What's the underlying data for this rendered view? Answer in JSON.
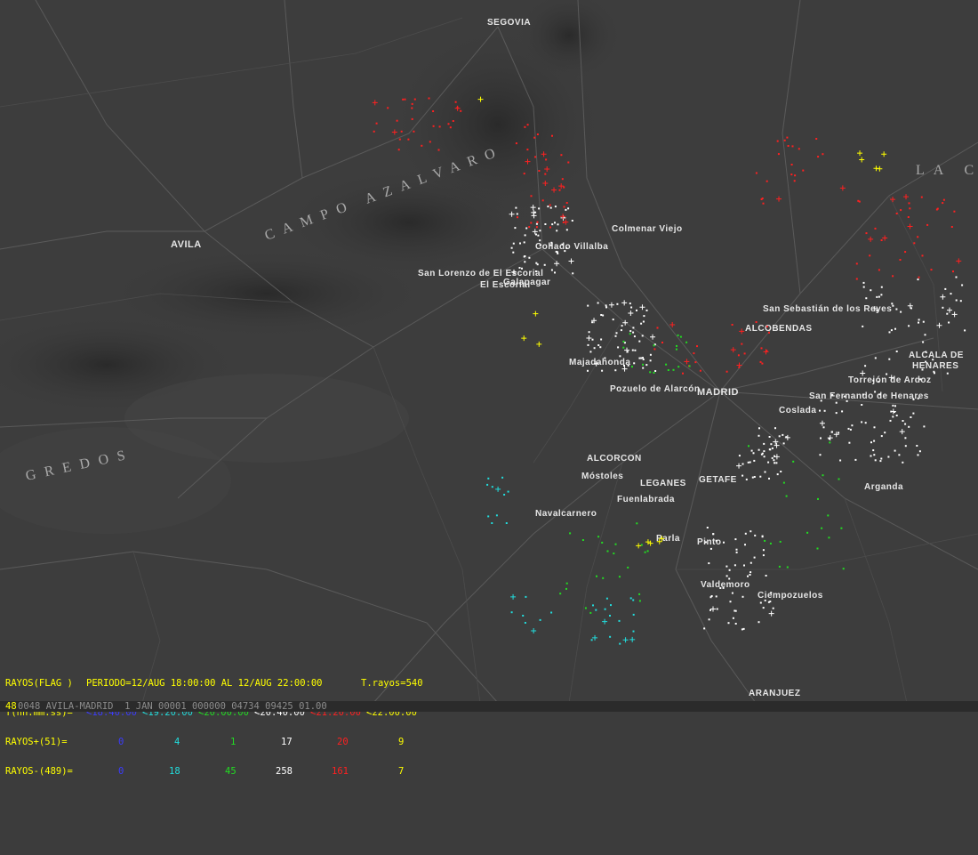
{
  "map": {
    "cities": [
      {
        "name": "SEGOVIA"
      },
      {
        "name": "AVILA"
      },
      {
        "name": "MADRID"
      },
      {
        "name": "ALCOBENDAS"
      },
      {
        "name": "ALCALA DE"
      },
      {
        "name": "HENARES"
      },
      {
        "name": "GETAFE"
      },
      {
        "name": "LEGANES"
      },
      {
        "name": "ALCORCON"
      },
      {
        "name": "ARANJUEZ"
      },
      {
        "name": "Colmenar Viejo"
      },
      {
        "name": "El Escorial"
      },
      {
        "name": "Majadahonda"
      },
      {
        "name": "Fuenlabrada"
      },
      {
        "name": "Móstoles"
      },
      {
        "name": "Parla"
      },
      {
        "name": "Pinto"
      },
      {
        "name": "Valdemoro"
      },
      {
        "name": "Ciempozuelos"
      },
      {
        "name": "Arganda"
      },
      {
        "name": "Coslada"
      },
      {
        "name": "Navalcarnero"
      },
      {
        "name": "San Sebastián de los Reyes"
      },
      {
        "name": "Torrejón de Ardoz"
      },
      {
        "name": "San Fernando de Henares"
      },
      {
        "name": "Collado Villalba"
      },
      {
        "name": "San Lorenzo de El Escorial"
      },
      {
        "name": "Galapagar"
      },
      {
        "name": "Pozuelo de Alarcón"
      }
    ],
    "regions": [
      {
        "name": "GREDOS"
      },
      {
        "name": "CAMPO AZALVARO"
      },
      {
        "name": "LA CAMPIÑA"
      }
    ]
  },
  "strikes": [
    {
      "type": "x",
      "color": "#ffffff",
      "count": 320
    },
    {
      "type": "x",
      "color": "#ff2020",
      "count": 130
    },
    {
      "type": "x",
      "color": "#22dd22",
      "count": 60
    },
    {
      "type": "x",
      "color": "#22dddd",
      "count": 30
    },
    {
      "type": "plus",
      "color": "#ffffff",
      "count": 40
    },
    {
      "type": "plus",
      "color": "#ff2020",
      "count": 25
    },
    {
      "type": "plus",
      "color": "#ffff00",
      "count": 14
    },
    {
      "type": "plus",
      "color": "#22dddd",
      "count": 7
    }
  ],
  "legend": {
    "title": "RAYOS(FLAG )",
    "period": "PERIODO=12/AUG 18:00:00 AL 12/AUG 22:00:00",
    "total": "T.rayos=540",
    "time_label": "T(hh:mm:ss)=",
    "time_bins": [
      {
        "label": "<18:40:00",
        "color": "#3b3bff"
      },
      {
        "label": "<19:20:00",
        "color": "#22dddd"
      },
      {
        "label": "<20:00:00",
        "color": "#22dd22"
      },
      {
        "label": "<20:40:00",
        "color": "#ffffff"
      },
      {
        "label": "<21:20:00",
        "color": "#ff2020"
      },
      {
        "label": "<22:00:00",
        "color": "#ffff00"
      }
    ],
    "positive_label": "RAYOS+(51)=",
    "positive_counts": [
      "0",
      "4",
      "1",
      "17",
      "20",
      "9"
    ],
    "negative_label": "RAYOS-(489)=",
    "negative_counts": [
      "0",
      "18",
      "45",
      "258",
      "161",
      "7"
    ]
  },
  "status": {
    "frame": "48",
    "text": "0048 AVILA-MADRID  1 JAN 00001 000000 04734 09425 01.00"
  }
}
